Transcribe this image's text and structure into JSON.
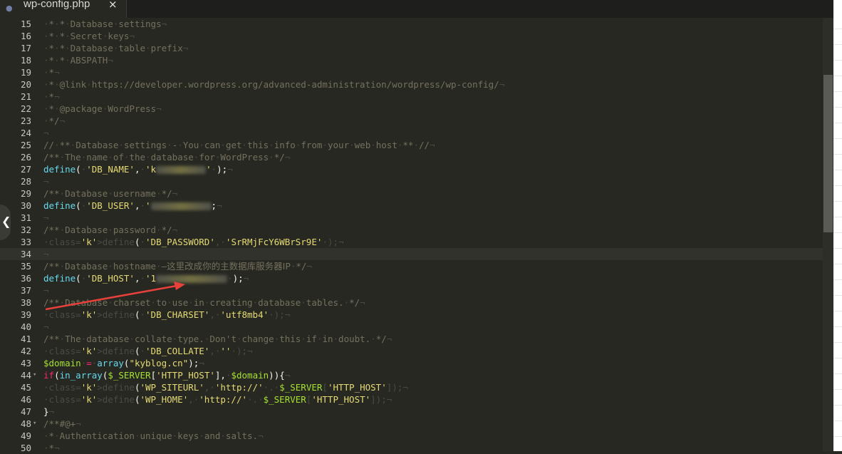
{
  "tab": {
    "title": "wp-config.php",
    "icon": "php-elephant-icon",
    "close": "×"
  },
  "colors": {
    "background": "#272822",
    "keyword": "#66d9ef",
    "string": "#e6db74",
    "comment": "#75715e",
    "variable": "#a6e22e",
    "arrow": "#e8403a"
  },
  "lines": [
    {
      "n": "15",
      "t": " * * Database settings"
    },
    {
      "n": "16",
      "t": " * * Secret keys"
    },
    {
      "n": "17",
      "t": " * * Database table prefix"
    },
    {
      "n": "18",
      "t": " * * ABSPATH"
    },
    {
      "n": "19",
      "t": " *"
    },
    {
      "n": "20",
      "t": " * @link https://developer.wordpress.org/advanced-administration/wordpress/wp-config/"
    },
    {
      "n": "21",
      "t": " *"
    },
    {
      "n": "22",
      "t": " * @package WordPress"
    },
    {
      "n": "23",
      "t": " */"
    },
    {
      "n": "24",
      "t": ""
    },
    {
      "n": "25",
      "t": "// ** Database settings - You can get this info from your web host ** //"
    },
    {
      "n": "26",
      "t": "/** The name of the database for WordPress */"
    },
    {
      "n": "27",
      "t": "define( 'DB_NAME', 'k' );"
    },
    {
      "n": "28",
      "t": ""
    },
    {
      "n": "29",
      "t": "/** Database username */"
    },
    {
      "n": "30",
      "t": "define( 'DB_USER', '' );"
    },
    {
      "n": "31",
      "t": ""
    },
    {
      "n": "32",
      "t": "/** Database password */"
    },
    {
      "n": "33",
      "t": "define( 'DB_PASSWORD', 'SrRMjFcY6WBrSr9E' );"
    },
    {
      "n": "34",
      "t": ""
    },
    {
      "n": "35",
      "t": "/** Database hostname —这里改成你的主数据库服务器IP */"
    },
    {
      "n": "36",
      "t": "define( 'DB_HOST', '1' );"
    },
    {
      "n": "37",
      "t": ""
    },
    {
      "n": "38",
      "t": "/** Database charset to use in creating database tables. */"
    },
    {
      "n": "39",
      "t": "define( 'DB_CHARSET', 'utf8mb4' );"
    },
    {
      "n": "40",
      "t": ""
    },
    {
      "n": "41",
      "t": "/** The database collate type. Don't change this if in doubt. */"
    },
    {
      "n": "42",
      "t": "define( 'DB_COLLATE', '' );"
    },
    {
      "n": "43",
      "t": "$domain = array(\"kyblog.cn\");"
    },
    {
      "n": "44",
      "t": "if(in_array($_SERVER['HTTP_HOST'], $domain)){"
    },
    {
      "n": "45",
      "t": "define('WP_SITEURL', 'http://' . $_SERVER['HTTP_HOST']);"
    },
    {
      "n": "46",
      "t": "define('WP_HOME', 'http://' . $_SERVER['HTTP_HOST']);"
    },
    {
      "n": "47",
      "t": "}"
    },
    {
      "n": "48",
      "t": "/**#@+"
    },
    {
      "n": "49",
      "t": " * Authentication unique keys and salts."
    },
    {
      "n": "50",
      "t": " *"
    }
  ]
}
